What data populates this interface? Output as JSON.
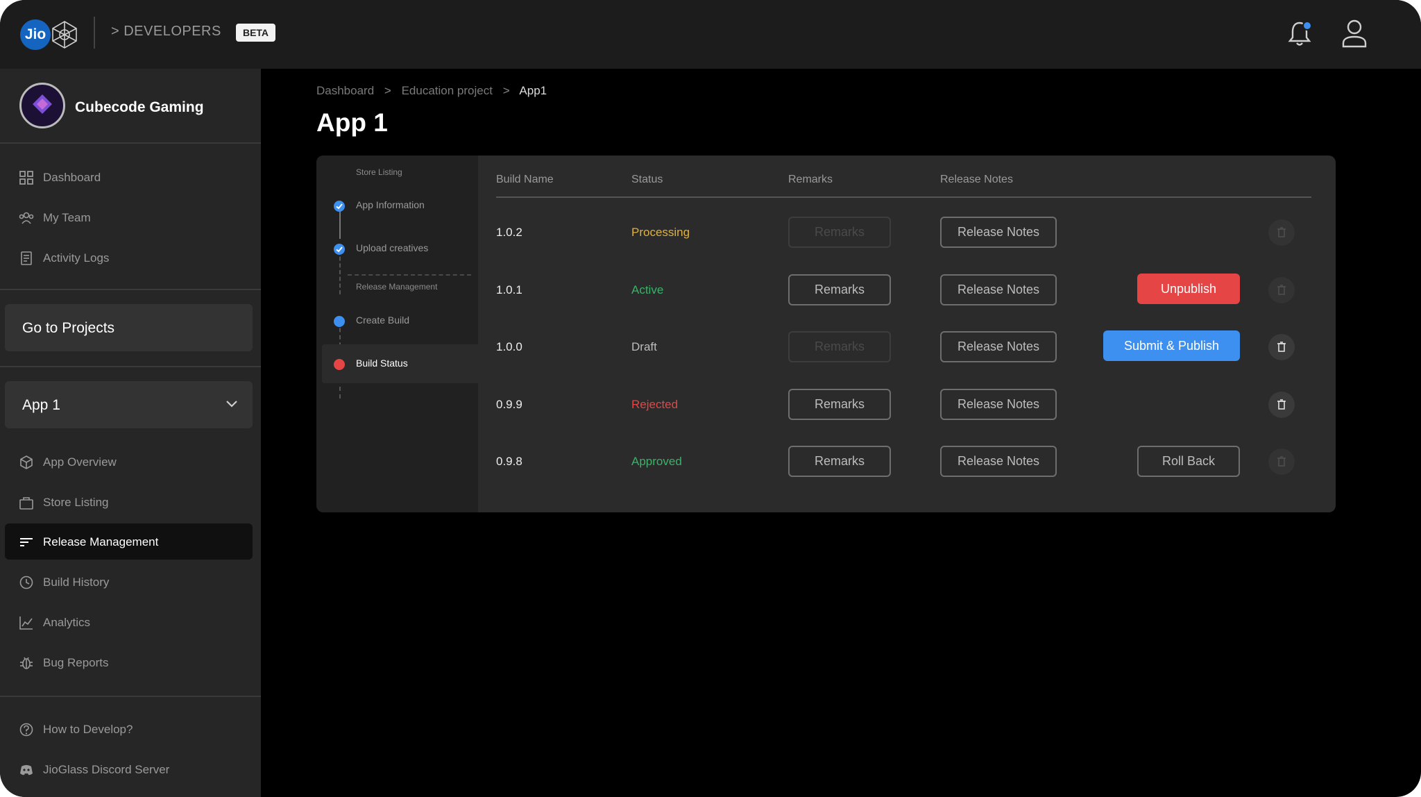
{
  "header": {
    "logo_text": "Jio",
    "developers_label": "> DEVELOPERS",
    "beta_badge": "BETA",
    "icons": [
      "notification-bell-icon",
      "user-profile-icon"
    ],
    "notification_dot_color": "#3d8ff0"
  },
  "sidebar": {
    "org_name": "Cubecode Gaming",
    "top_items": [
      {
        "label": "Dashboard",
        "icon": "grid-icon"
      },
      {
        "label": "My Team",
        "icon": "team-icon"
      },
      {
        "label": "Activity Logs",
        "icon": "logs-icon"
      }
    ],
    "go_to_projects": "Go to Projects",
    "app_select": {
      "selected": "App 1"
    },
    "app_items": [
      {
        "label": "App Overview",
        "icon": "cube-icon"
      },
      {
        "label": "Store Listing",
        "icon": "bag-icon"
      },
      {
        "label": "Release Management",
        "icon": "release-icon",
        "active": true
      },
      {
        "label": "Build History",
        "icon": "history-icon"
      },
      {
        "label": "Analytics",
        "icon": "chart-icon"
      },
      {
        "label": "Bug Reports",
        "icon": "bug-icon"
      }
    ],
    "bottom_items": [
      {
        "label": "How to Develop?",
        "icon": "help-icon"
      },
      {
        "label": "JioGlass Discord Server",
        "icon": "discord-icon"
      }
    ]
  },
  "breadcrumb": [
    "Dashboard",
    "Education project",
    "App1"
  ],
  "page_title": "App 1",
  "steps": {
    "section_store": "Store Listing",
    "app_information": "App Information",
    "upload_creatives": "Upload creatives",
    "section_release": "Release Management",
    "create_build": "Create Build",
    "build_status": "Build Status"
  },
  "table": {
    "headers": {
      "build_name": "Build Name",
      "status": "Status",
      "remarks": "Remarks",
      "release_notes": "Release Notes"
    },
    "rows": [
      {
        "name": "1.0.2",
        "status": "Processing",
        "status_color": "#e0b040",
        "remarks": "Remarks",
        "notes": "Release Notes",
        "action": ""
      },
      {
        "name": "1.0.1",
        "status": "Active",
        "status_color": "#3bb26a",
        "remarks": "Remarks",
        "notes": "Release Notes",
        "action": "Unpublish"
      },
      {
        "name": "1.0.0",
        "status": "Draft",
        "status_color": "#bdbdbd",
        "remarks": "Remarks",
        "notes": "Release Notes",
        "action": "Submit & Publish"
      },
      {
        "name": "0.9.9",
        "status": "Rejected",
        "status_color": "#e64545",
        "remarks": "Remarks",
        "notes": "Release Notes",
        "action": ""
      },
      {
        "name": "0.9.8",
        "status": "Approved",
        "status_color": "#3bb26a",
        "remarks": "Remarks",
        "notes": "Release Notes",
        "action": "Roll Back"
      }
    ]
  }
}
